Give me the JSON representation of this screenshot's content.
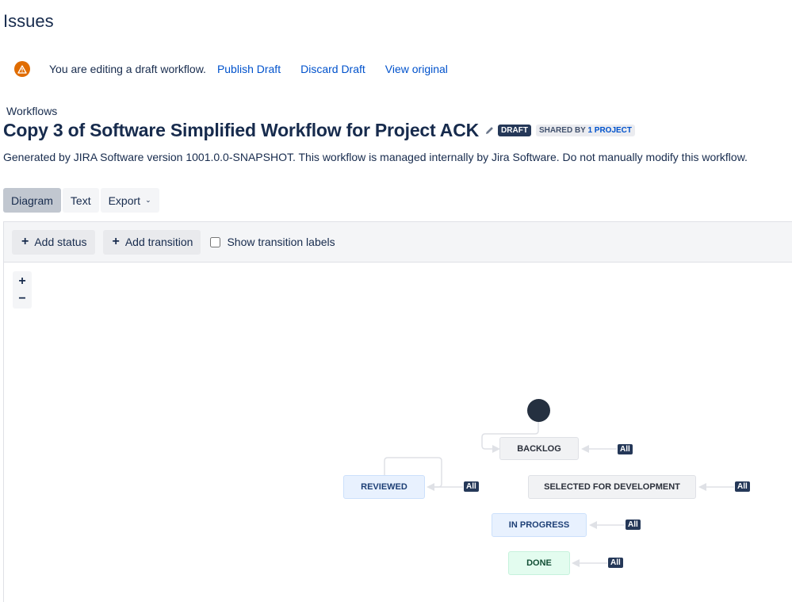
{
  "page": {
    "title": "Issues"
  },
  "banner": {
    "icon": "warning-icon",
    "message": "You are editing a draft workflow.",
    "links": [
      "Publish Draft",
      "Discard Draft",
      "View original"
    ]
  },
  "breadcrumb": "Workflows",
  "workflow": {
    "title": "Copy 3 of Software Simplified Workflow for Project ACK",
    "edit_icon": "pencil-icon",
    "draft_badge": "DRAFT",
    "shared_prefix": "SHARED BY",
    "shared_link": "1 PROJECT",
    "description": "Generated by JIRA Software version 1001.0.0-SNAPSHOT. This workflow is managed internally by Jira Software. Do not manually modify this workflow."
  },
  "view_tabs": {
    "diagram": "Diagram",
    "text": "Text",
    "export": "Export",
    "active": "Diagram"
  },
  "toolbar": {
    "add_status": "Add status",
    "add_transition": "Add transition",
    "show_labels": "Show transition labels",
    "show_labels_checked": false
  },
  "zoom": {
    "in": "+",
    "out": "−"
  },
  "diagram": {
    "statuses": [
      {
        "name": "BACKLOG",
        "category": "todo",
        "global_transition": "All"
      },
      {
        "name": "REVIEWED",
        "category": "in-progress",
        "global_transition": "All"
      },
      {
        "name": "SELECTED FOR DEVELOPMENT",
        "category": "todo",
        "global_transition": "All"
      },
      {
        "name": "IN PROGRESS",
        "category": "in-progress",
        "global_transition": "All"
      },
      {
        "name": "DONE",
        "category": "done",
        "global_transition": "All"
      }
    ],
    "colors": {
      "todo": "#f1f2f4",
      "in-progress": "#e8f1fe",
      "done": "#e3fcef",
      "badge": "#253858",
      "start": "#253040"
    }
  }
}
